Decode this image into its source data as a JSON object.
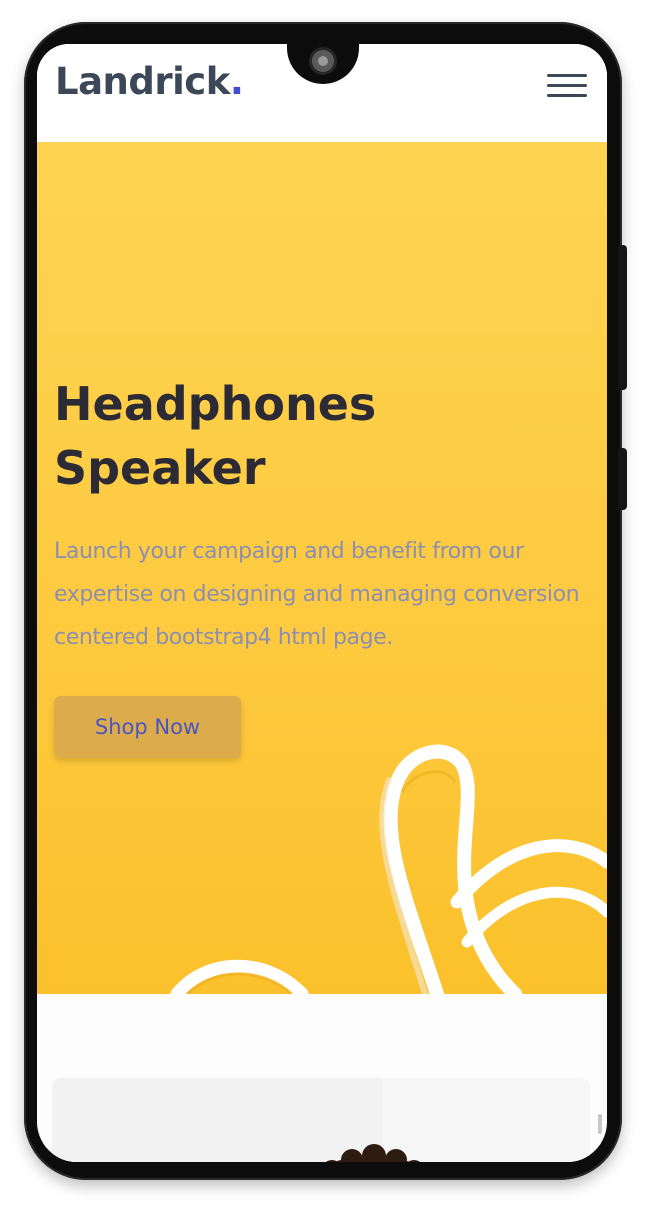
{
  "header": {
    "logo_text": "Landrick",
    "logo_dot": ".",
    "menu_icon": "hamburger-menu-icon"
  },
  "hero": {
    "title_line1": "Headphones",
    "title_line2": "Speaker",
    "description": "Launch your campaign and benefit from our expertise on designing and managing conversion centered bootstrap4 html page.",
    "cta_label": "Shop Now"
  },
  "colors": {
    "hero_background": "#fdca40",
    "logo_text": "#3c4858",
    "logo_accent": "#3e4ccd",
    "title": "#2b2a35",
    "description": "#8c8fb0",
    "cta_background": "#dcab4c",
    "cta_text": "#4a56c4"
  }
}
